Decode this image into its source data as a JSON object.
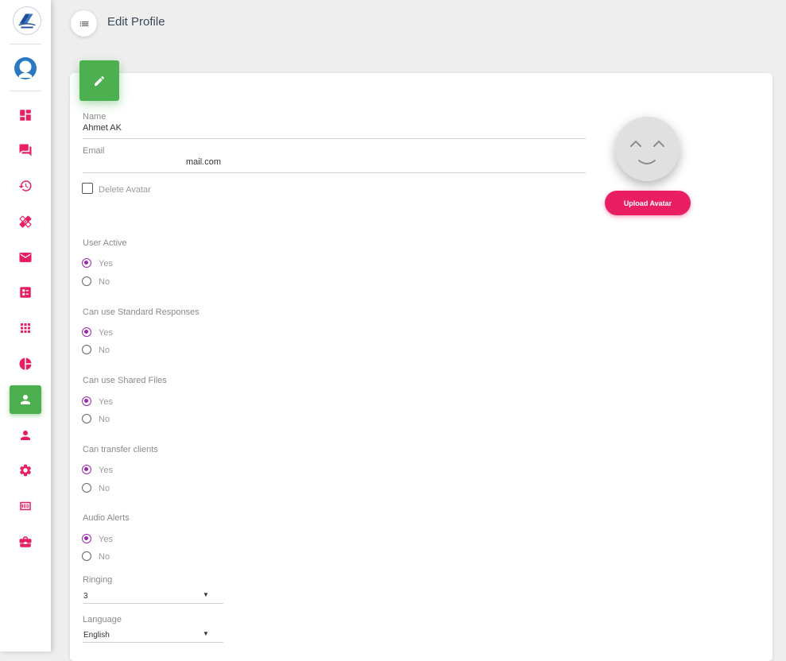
{
  "header": {
    "title": "Edit Profile",
    "menu_icon": "list-icon"
  },
  "sidebar": {
    "logo_icon": "company-logo-icon",
    "user_icon": "user-avatar-icon",
    "accent_color": "#e91e63",
    "active_color": "#4caf50",
    "items": [
      {
        "icon": "dashboard-icon"
      },
      {
        "icon": "forum-icon"
      },
      {
        "icon": "history-icon"
      },
      {
        "icon": "healing-icon"
      },
      {
        "icon": "mail-icon"
      },
      {
        "icon": "form-icon"
      },
      {
        "icon": "apps-icon"
      },
      {
        "icon": "pie-chart-icon"
      },
      {
        "icon": "person-icon",
        "active": true
      },
      {
        "icon": "person-icon"
      },
      {
        "icon": "settings-icon"
      },
      {
        "icon": "counter-icon"
      },
      {
        "icon": "briefcase-icon"
      }
    ]
  },
  "form": {
    "name_label": "Name",
    "name_value": "Ahmet AK",
    "email_label": "Email",
    "email_value": "mail.com",
    "delete_avatar_label": "Delete Avatar",
    "delete_avatar_checked": false,
    "radio_groups": [
      {
        "label": "User Active",
        "options": [
          "Yes",
          "No"
        ],
        "selected": "Yes"
      },
      {
        "label": "Can use Standard Responses",
        "options": [
          "Yes",
          "No"
        ],
        "selected": "Yes"
      },
      {
        "label": "Can use Shared Files",
        "options": [
          "Yes",
          "No"
        ],
        "selected": "Yes"
      },
      {
        "label": "Can transfer clients",
        "options": [
          "Yes",
          "No"
        ],
        "selected": "Yes"
      },
      {
        "label": "Audio Alerts",
        "options": [
          "Yes",
          "No"
        ],
        "selected": "Yes"
      }
    ],
    "ringing_label": "Ringing",
    "ringing_value": "3",
    "language_label": "Language",
    "language_value": "English",
    "radio_color": "#9c27b0"
  },
  "avatar": {
    "upload_label": "Upload Avatar",
    "icon": "smiley-face-icon",
    "button_color": "#e91e63"
  }
}
